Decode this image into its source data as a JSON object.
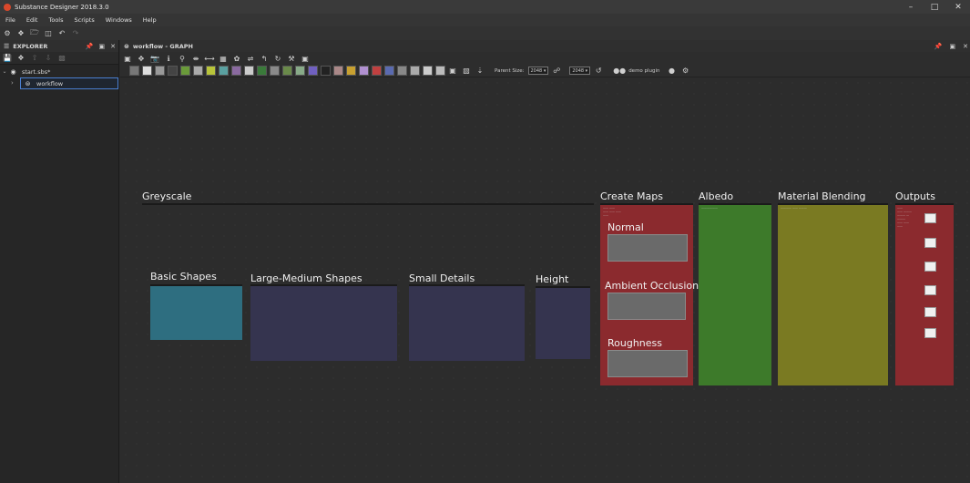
{
  "window": {
    "title": "Substance Designer 2018.3.0"
  },
  "menu": [
    "File",
    "Edit",
    "Tools",
    "Scripts",
    "Windows",
    "Help"
  ],
  "explorer": {
    "title": "EXPLORER",
    "package": "start.sbs*",
    "graph": "workflow"
  },
  "graph_panel": {
    "title": "workflow - GRAPH",
    "parent_size_label": "Parent Size:",
    "parent_size_value": "2048",
    "size_value": "2048",
    "plugin_label": "demo plugin"
  },
  "frames": {
    "greyscale": "Greyscale",
    "basic_shapes": "Basic Shapes",
    "large_medium_shapes": "Large-Medium Shapes",
    "small_details": "Small Details",
    "height": "Height",
    "create_maps": "Create Maps",
    "normal": "Normal",
    "ambient_occlusion": "Ambient Occlusion",
    "roughness": "Roughness",
    "albedo": "Albedo",
    "material_blending": "Material Blending",
    "outputs": "Outputs"
  },
  "colors": {
    "basic_shapes": "#2e6e80",
    "dark_blue_frame": "#35344f",
    "create_maps": "#8b2a2e",
    "albedo": "#3d7a2a",
    "material_blending": "#7a7a22",
    "outputs": "#8b2a2e"
  }
}
